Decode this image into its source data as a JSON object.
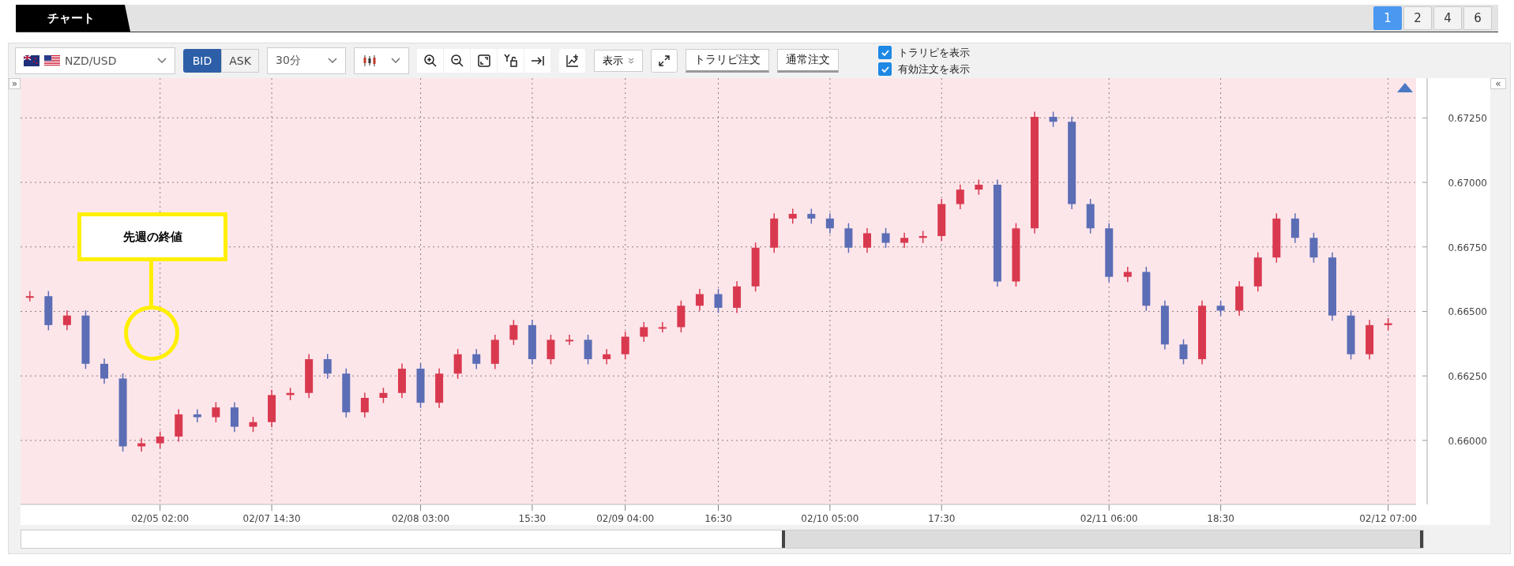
{
  "header": {
    "tab": "チャート",
    "layouts": [
      {
        "label": "1",
        "selected": true
      },
      {
        "label": "2",
        "selected": false
      },
      {
        "label": "4",
        "selected": false
      },
      {
        "label": "6",
        "selected": false
      }
    ]
  },
  "toolbar": {
    "pair": "NZD/USD",
    "sides": [
      {
        "label": "BID",
        "selected": true
      },
      {
        "label": "ASK",
        "selected": false
      }
    ],
    "timeframe": "30分",
    "display_menu": "表示",
    "order_buttons": [
      "トラリピ注文",
      "通常注文"
    ],
    "toggles": [
      {
        "label": "トラリピを表示",
        "checked": true
      },
      {
        "label": "有効注文を表示",
        "checked": true
      }
    ]
  },
  "chart": {
    "expand_left": "»",
    "collapse_right": "«",
    "annotation": "先週の終値",
    "chart_data": {
      "type": "candlestick",
      "grid": true,
      "ylim": [
        0.65752,
        0.67404
      ],
      "categories": [
        null,
        null,
        null,
        null,
        null,
        null,
        null,
        "02/05 02:00",
        null,
        null,
        null,
        null,
        null,
        "02/07 14:30",
        null,
        null,
        null,
        null,
        null,
        null,
        null,
        "02/08 03:00",
        null,
        null,
        null,
        null,
        null,
        "15:30",
        null,
        null,
        null,
        null,
        "02/09 04:00",
        null,
        null,
        null,
        null,
        "16:30",
        null,
        null,
        null,
        null,
        null,
        "02/10 05:00",
        null,
        null,
        null,
        null,
        null,
        "17:30",
        null,
        null,
        null,
        null,
        null,
        null,
        null,
        null,
        "02/11 06:00",
        null,
        null,
        null,
        null,
        null,
        "18:30",
        null,
        null,
        null,
        null,
        null,
        null,
        null,
        null,
        "02/12 07:00"
      ],
      "ohlc": [
        [
          0.66559,
          0.66579,
          0.66539,
          0.66559
        ],
        [
          0.66559,
          0.66579,
          0.66427,
          0.66447
        ],
        [
          0.66447,
          0.66504,
          0.66427,
          0.66484
        ],
        [
          0.66484,
          0.66504,
          0.66277,
          0.66297
        ],
        [
          0.66297,
          0.66317,
          0.6622,
          0.6624
        ],
        [
          0.6624,
          0.6626,
          0.65957,
          0.65977
        ],
        [
          0.65977,
          0.66009,
          0.65957,
          0.65989
        ],
        [
          0.65989,
          0.66035,
          0.65969,
          0.66015
        ],
        [
          0.66015,
          0.66121,
          0.65995,
          0.66101
        ],
        [
          0.66101,
          0.66121,
          0.6607,
          0.6609
        ],
        [
          0.6609,
          0.66148,
          0.6607,
          0.66128
        ],
        [
          0.66128,
          0.66148,
          0.66033,
          0.66053
        ],
        [
          0.66053,
          0.66091,
          0.66033,
          0.66071
        ],
        [
          0.66071,
          0.66196,
          0.66051,
          0.66176
        ],
        [
          0.66176,
          0.66204,
          0.66156,
          0.66184
        ],
        [
          0.66184,
          0.66335,
          0.66164,
          0.66315
        ],
        [
          0.66315,
          0.66335,
          0.66239,
          0.66259
        ],
        [
          0.66259,
          0.66279,
          0.66089,
          0.66109
        ],
        [
          0.66109,
          0.66185,
          0.66089,
          0.66165
        ],
        [
          0.66165,
          0.66204,
          0.66145,
          0.66184
        ],
        [
          0.66184,
          0.66298,
          0.66164,
          0.66278
        ],
        [
          0.66278,
          0.66298,
          0.66126,
          0.66146
        ],
        [
          0.66146,
          0.66279,
          0.66126,
          0.66259
        ],
        [
          0.66259,
          0.66354,
          0.66239,
          0.66334
        ],
        [
          0.66334,
          0.66354,
          0.66277,
          0.66297
        ],
        [
          0.66297,
          0.6641,
          0.66277,
          0.6639
        ],
        [
          0.6639,
          0.66467,
          0.6637,
          0.66447
        ],
        [
          0.66447,
          0.66467,
          0.66295,
          0.66315
        ],
        [
          0.66315,
          0.6641,
          0.66295,
          0.6639
        ],
        [
          0.6639,
          0.6641,
          0.6637,
          0.6639
        ],
        [
          0.6639,
          0.6641,
          0.66295,
          0.66315
        ],
        [
          0.66315,
          0.66354,
          0.66295,
          0.66334
        ],
        [
          0.66334,
          0.66422,
          0.66314,
          0.66402
        ],
        [
          0.66402,
          0.66459,
          0.66382,
          0.66439
        ],
        [
          0.66439,
          0.66459,
          0.66419,
          0.66439
        ],
        [
          0.66439,
          0.66542,
          0.66419,
          0.66522
        ],
        [
          0.66522,
          0.66587,
          0.66502,
          0.66567
        ],
        [
          0.66567,
          0.66587,
          0.66494,
          0.66514
        ],
        [
          0.66514,
          0.66617,
          0.66494,
          0.66597
        ],
        [
          0.66597,
          0.66767,
          0.66577,
          0.66747
        ],
        [
          0.66747,
          0.6688,
          0.66727,
          0.6686
        ],
        [
          0.6686,
          0.66898,
          0.6684,
          0.66878
        ],
        [
          0.66878,
          0.66898,
          0.6684,
          0.6686
        ],
        [
          0.6686,
          0.6688,
          0.66802,
          0.66822
        ],
        [
          0.66822,
          0.66842,
          0.66727,
          0.66747
        ],
        [
          0.66747,
          0.66823,
          0.66727,
          0.66803
        ],
        [
          0.66803,
          0.66823,
          0.66746,
          0.66766
        ],
        [
          0.66766,
          0.66805,
          0.66746,
          0.66785
        ],
        [
          0.66785,
          0.66812,
          0.66765,
          0.66792
        ],
        [
          0.66792,
          0.66936,
          0.66772,
          0.66916
        ],
        [
          0.66916,
          0.66992,
          0.66896,
          0.66972
        ],
        [
          0.66972,
          0.67011,
          0.66952,
          0.66991
        ],
        [
          0.66991,
          0.67011,
          0.66596,
          0.66616
        ],
        [
          0.66616,
          0.66842,
          0.66596,
          0.66822
        ],
        [
          0.66822,
          0.67274,
          0.66802,
          0.67254
        ],
        [
          0.67254,
          0.67274,
          0.67215,
          0.67235
        ],
        [
          0.67235,
          0.67255,
          0.66896,
          0.66916
        ],
        [
          0.66916,
          0.66936,
          0.66802,
          0.66822
        ],
        [
          0.66822,
          0.66842,
          0.66614,
          0.66634
        ],
        [
          0.66634,
          0.66673,
          0.66614,
          0.66653
        ],
        [
          0.66653,
          0.66673,
          0.66502,
          0.66522
        ],
        [
          0.66522,
          0.66542,
          0.66352,
          0.66372
        ],
        [
          0.66372,
          0.66392,
          0.66295,
          0.66315
        ],
        [
          0.66315,
          0.66542,
          0.66295,
          0.66522
        ],
        [
          0.66522,
          0.66542,
          0.66483,
          0.66503
        ],
        [
          0.66503,
          0.66617,
          0.66483,
          0.66597
        ],
        [
          0.66597,
          0.66729,
          0.66577,
          0.66709
        ],
        [
          0.66709,
          0.6688,
          0.66689,
          0.6686
        ],
        [
          0.6686,
          0.6688,
          0.66765,
          0.66785
        ],
        [
          0.66785,
          0.66805,
          0.66689,
          0.66709
        ],
        [
          0.66709,
          0.66729,
          0.66464,
          0.66484
        ],
        [
          0.66484,
          0.66504,
          0.66314,
          0.66334
        ],
        [
          0.66334,
          0.66467,
          0.66314,
          0.66447
        ],
        [
          0.66447,
          0.66474,
          0.66427,
          0.66454
        ]
      ],
      "yticks": [
        {
          "value": 0.66,
          "label": "0.66000"
        },
        {
          "value": 0.6625,
          "label": "0.66250"
        },
        {
          "value": 0.665,
          "label": "0.66500"
        },
        {
          "value": 0.6675,
          "label": "0.66750"
        },
        {
          "value": 0.67,
          "label": "0.67000"
        },
        {
          "value": 0.6725,
          "label": "0.67250"
        }
      ]
    }
  }
}
